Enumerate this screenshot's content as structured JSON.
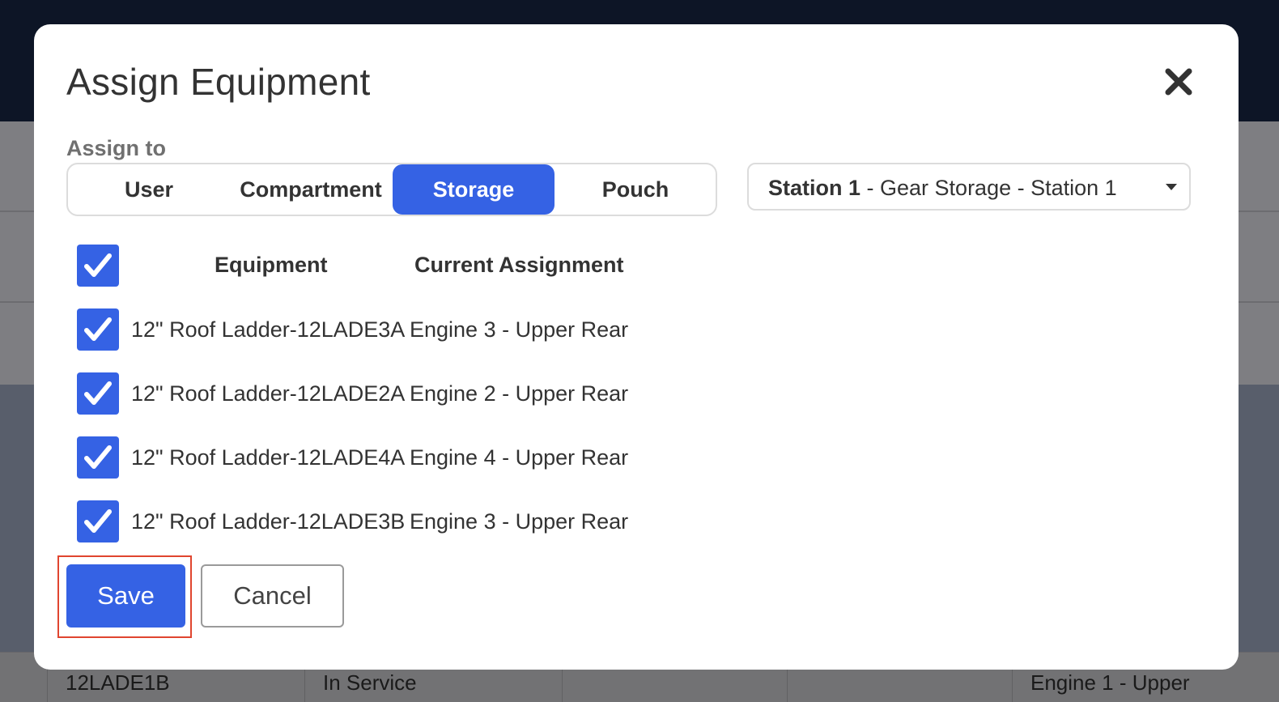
{
  "modal": {
    "title": "Assign Equipment",
    "assign_label": "Assign to",
    "tabs": [
      {
        "label": "User",
        "active": false
      },
      {
        "label": "Compartment",
        "active": false
      },
      {
        "label": "Storage",
        "active": true
      },
      {
        "label": "Pouch",
        "active": false
      }
    ],
    "location_select": {
      "bold_part": "Station 1",
      "rest": " - Gear Storage - Station 1"
    },
    "table": {
      "select_all_checked": true,
      "headers": [
        "Equipment",
        "Current Assignment"
      ],
      "rows": [
        {
          "equipment": "12\" Roof Ladder-12LADE3A",
          "assignment": "Engine 3 - Upper Rear",
          "checked": true
        },
        {
          "equipment": "12\" Roof Ladder-12LADE2A",
          "assignment": "Engine 2 - Upper Rear",
          "checked": true
        },
        {
          "equipment": "12\" Roof Ladder-12LADE4A",
          "assignment": "Engine 4 - Upper Rear",
          "checked": true
        },
        {
          "equipment": "12\" Roof Ladder-12LADE3B",
          "assignment": "Engine 3 - Upper Rear",
          "checked": true
        }
      ]
    },
    "save_label": "Save",
    "cancel_label": "Cancel"
  },
  "background_row": {
    "cells": [
      "12LADE1B",
      "In Service",
      "",
      "",
      "Engine 1 - Upper"
    ]
  },
  "colors": {
    "accent": "#3562e4",
    "highlight_border": "#e0452f",
    "topbar": "#0d1526"
  },
  "icons": {
    "close": "close-icon",
    "checkbox": "checkmark-icon",
    "dropdown": "caret-down-icon"
  }
}
